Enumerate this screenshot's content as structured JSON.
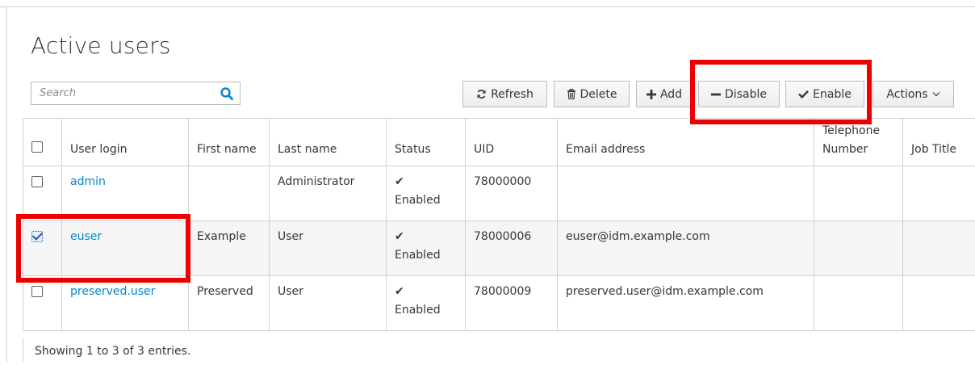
{
  "page": {
    "title": "Active users"
  },
  "search": {
    "placeholder": "Search",
    "value": "",
    "icon": "search-icon"
  },
  "toolbar": {
    "refresh": {
      "label": "Refresh",
      "icon": "refresh-icon"
    },
    "delete": {
      "label": "Delete",
      "icon": "trash-icon"
    },
    "add": {
      "label": "Add",
      "icon": "plus-icon"
    },
    "disable": {
      "label": "Disable",
      "icon": "minus-icon"
    },
    "enable": {
      "label": "Enable",
      "icon": "check-icon"
    },
    "actions": {
      "label": "Actions",
      "icon": "chevron-down-icon"
    }
  },
  "table": {
    "columns": [
      "",
      "User login",
      "First name",
      "Last name",
      "Status",
      "UID",
      "Email address",
      "Telephone Number",
      "Job Title"
    ],
    "rows": [
      {
        "selected": false,
        "login": "admin",
        "first_name": "",
        "last_name": "Administrator",
        "status": "Enabled",
        "uid": "78000000",
        "email": "",
        "phone": "",
        "job_title": ""
      },
      {
        "selected": true,
        "login": "euser",
        "first_name": "Example",
        "last_name": "User",
        "status": "Enabled",
        "uid": "78000006",
        "email": "euser@idm.example.com",
        "phone": "",
        "job_title": ""
      },
      {
        "selected": false,
        "login": "preserved.user",
        "first_name": "Preserved",
        "last_name": "User",
        "status": "Enabled",
        "uid": "78000009",
        "email": "preserved.user@idm.example.com",
        "phone": "",
        "job_title": ""
      }
    ]
  },
  "footer": {
    "text": "Showing 1 to 3 of 3 entries."
  },
  "colors": {
    "link": "#0088ce",
    "highlight": "#ee0000",
    "border": "#d1d1d1"
  }
}
